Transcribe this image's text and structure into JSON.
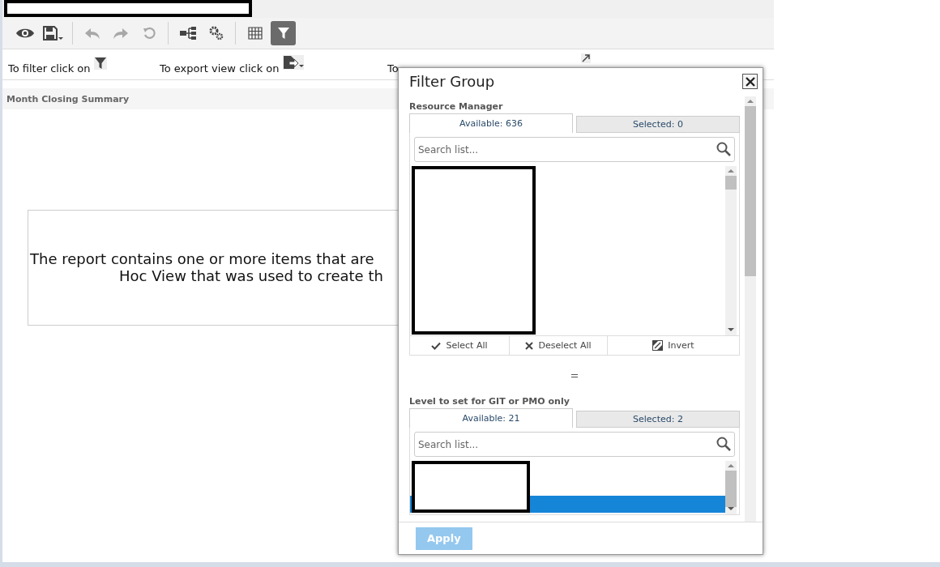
{
  "toolbar": [
    {
      "kind": "view",
      "disabled": false,
      "selected": false
    },
    {
      "kind": "save",
      "disabled": false,
      "selected": false
    },
    {
      "kind": "undo",
      "disabled": true,
      "selected": false
    },
    {
      "kind": "redo",
      "disabled": true,
      "selected": false
    },
    {
      "kind": "reset",
      "disabled": true,
      "selected": false
    },
    {
      "kind": "tree",
      "disabled": false,
      "selected": false
    },
    {
      "kind": "settings",
      "disabled": false,
      "selected": false
    },
    {
      "kind": "table",
      "disabled": false,
      "selected": false
    },
    {
      "kind": "filter",
      "disabled": false,
      "selected": true
    }
  ],
  "hints": [
    {
      "text": "To filter click on"
    },
    {
      "text": "To export view click on"
    },
    {
      "text": "To"
    }
  ],
  "report": {
    "title": "Month Closing Summary",
    "message_lines": [
      "The report contains one or more items that are",
      "Hoc View that was used to create th"
    ]
  },
  "dialog": {
    "title": "Filter Group",
    "sections": [
      {
        "label": "Resource Manager",
        "tabs": [
          {
            "label": "Available: 636",
            "selected": true
          },
          {
            "label": "Selected: 0",
            "selected": false
          }
        ],
        "search": {
          "placeholder": "Search list..."
        },
        "actions": [
          {
            "kind": "check",
            "label": "Select All"
          },
          {
            "kind": "cross",
            "label": "Deselect All"
          },
          {
            "kind": "invert",
            "label": "Invert"
          }
        ]
      },
      {
        "label": "Level to set for GIT or PMO only",
        "tabs": [
          {
            "label": "Available: 21",
            "selected": true
          },
          {
            "label": "Selected: 2",
            "selected": false
          }
        ],
        "search": {
          "placeholder": "Search list..."
        },
        "rows": [
          {
            "selected": true
          }
        ]
      }
    ],
    "apply": {
      "label": "Apply",
      "disabled": true
    }
  }
}
